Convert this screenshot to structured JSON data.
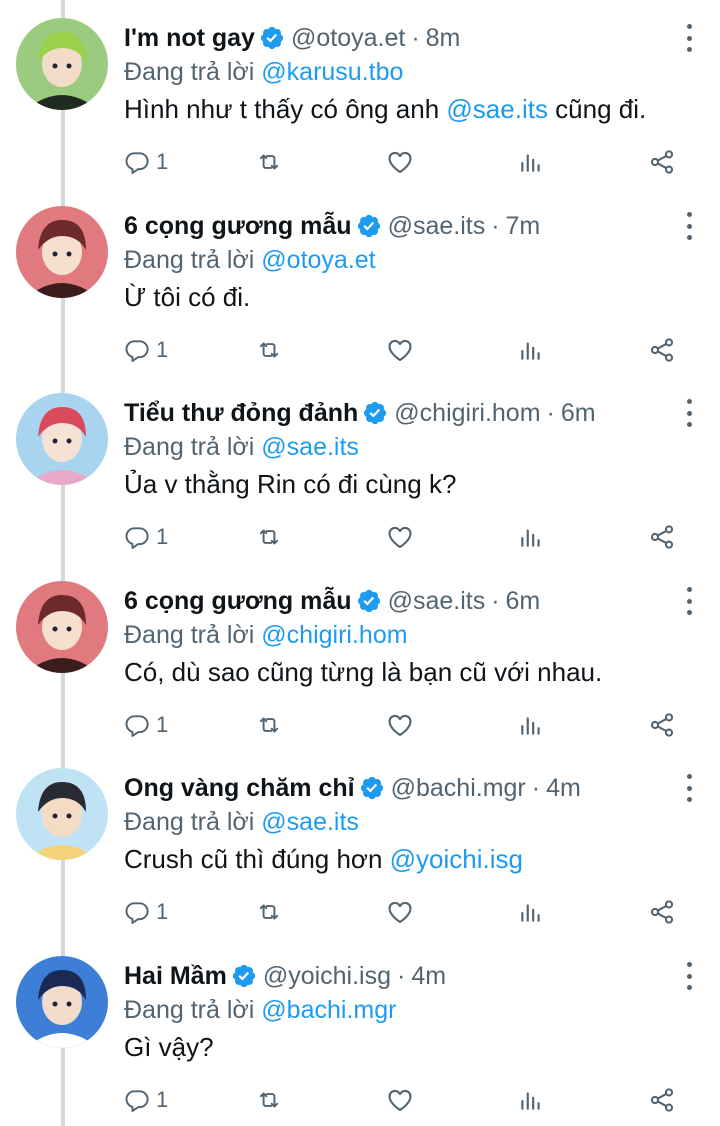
{
  "tweets": [
    {
      "name": "I'm not gay",
      "handle": "@otoya.et",
      "separator": "·",
      "time": "8m",
      "replying_prefix": "Đang trả lời",
      "replying_to": "@karusu.tbo",
      "text_parts": [
        "Hình như t thấy có ông anh ",
        "@sae.its",
        " cũng đi."
      ],
      "reply_count": "1",
      "avatar_colors": {
        "bg": "#9acb7f",
        "hair": "#9bd14a",
        "skin": "#f1dcc8",
        "accent": "#1e2a22"
      }
    },
    {
      "name": "6 cọng gương mẫu",
      "handle": "@sae.its",
      "separator": "·",
      "time": "7m",
      "replying_prefix": "Đang trả lời",
      "replying_to": "@otoya.et",
      "text_parts": [
        "Ừ tôi có đi.",
        "",
        ""
      ],
      "reply_count": "1",
      "avatar_colors": {
        "bg": "#e07a7f",
        "hair": "#6e2a2a",
        "skin": "#f5e0d0",
        "accent": "#3b1d1d"
      }
    },
    {
      "name": "Tiểu thư đỏng đảnh",
      "handle": "@chigiri.hom",
      "separator": "·",
      "time": "6m",
      "replying_prefix": "Đang trả lời",
      "replying_to": "@sae.its",
      "text_parts": [
        "Ủa v thằng Rin có đi cùng k?",
        "",
        ""
      ],
      "reply_count": "1",
      "avatar_colors": {
        "bg": "#a9d4ef",
        "hair": "#d94a5a",
        "skin": "#f6e2d4",
        "accent": "#e8a8c8"
      }
    },
    {
      "name": "6 cọng gương mẫu",
      "handle": "@sae.its",
      "separator": "·",
      "time": "6m",
      "replying_prefix": "Đang trả lời",
      "replying_to": "@chigiri.hom",
      "text_parts": [
        "Có, dù sao cũng từng là bạn cũ với nhau.",
        "",
        ""
      ],
      "reply_count": "1",
      "avatar_colors": {
        "bg": "#e07a7f",
        "hair": "#6e2a2a",
        "skin": "#f5e0d0",
        "accent": "#3b1d1d"
      }
    },
    {
      "name": "Ong vàng chăm chỉ",
      "handle": "@bachi.mgr",
      "separator": "·",
      "time": "4m",
      "replying_prefix": "Đang trả lời",
      "replying_to": "@sae.its",
      "text_parts": [
        "Crush cũ thì đúng hơn ",
        "@yoichi.isg",
        ""
      ],
      "reply_count": "1",
      "avatar_colors": {
        "bg": "#bfe3f5",
        "hair": "#2a2a35",
        "skin": "#f4dcc4",
        "accent": "#f3d27a"
      }
    },
    {
      "name": "Hai Mầm",
      "handle": "@yoichi.isg",
      "separator": "·",
      "time": "4m",
      "replying_prefix": "Đang trả lời",
      "replying_to": "@bachi.mgr",
      "text_parts": [
        "Gì vậy?",
        "",
        ""
      ],
      "reply_count": "1",
      "avatar_colors": {
        "bg": "#3d7fd6",
        "hair": "#1a2a55",
        "skin": "#f3dccb",
        "accent": "#ffffff"
      }
    }
  ],
  "colors": {
    "link": "#1d9bf0",
    "secondary_text": "#536471",
    "primary_text": "#0f1419",
    "thread_line": "#cfd9de"
  },
  "icons": {
    "verified": "verified-badge-icon",
    "more": "more-vertical-icon",
    "reply": "reply-icon",
    "retweet": "retweet-icon",
    "like": "heart-icon",
    "views": "views-icon",
    "share": "share-icon"
  }
}
